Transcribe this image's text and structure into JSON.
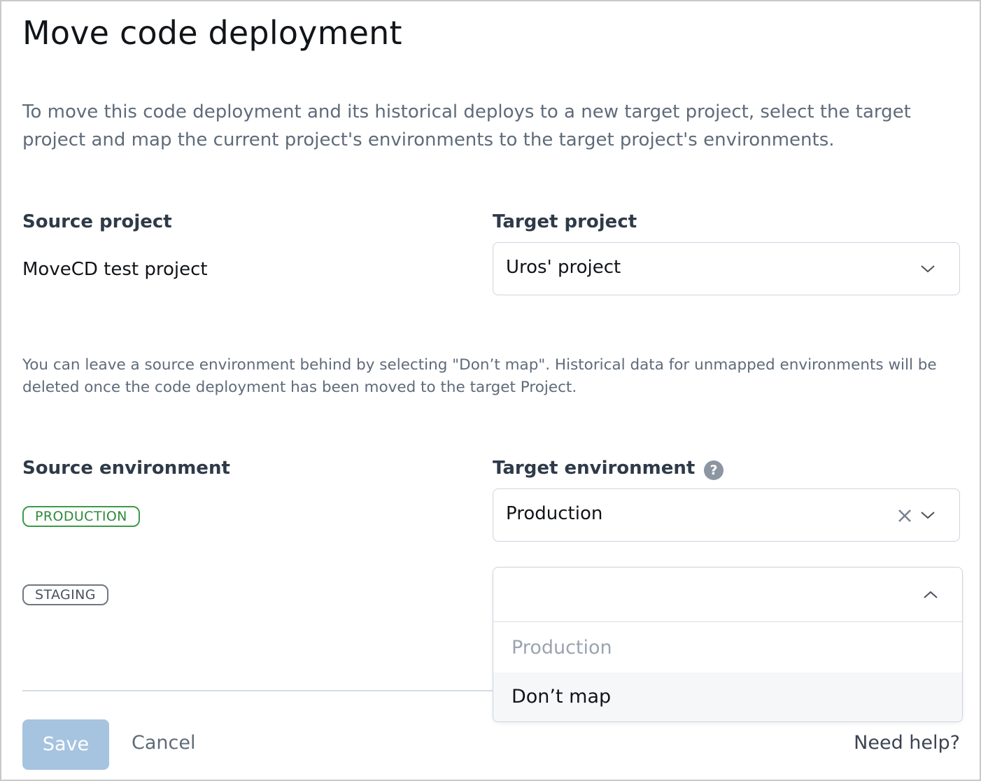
{
  "dialog": {
    "title": "Move code deployment",
    "intro": "To move this code deployment and its historical deploys to a new target project, select the target project and map the current project's environments to the target project's environments.",
    "source_project_label": "Source project",
    "source_project_value": "MoveCD test project",
    "target_project_label": "Target project",
    "target_project_value": "Uros' project",
    "note": "You can leave a source environment behind by selecting \"Don’t map\". Historical data for unmapped environments will be deleted once the code deployment has been moved to the target Project.",
    "source_env_label": "Source environment",
    "target_env_label": "Target environment",
    "help_icon_glyph": "?",
    "environments": [
      {
        "source": "PRODUCTION",
        "target": "Production"
      },
      {
        "source": "STAGING",
        "target": ""
      }
    ],
    "dropdown_options": [
      {
        "label": "Production",
        "disabled": true
      },
      {
        "label": "Don’t map",
        "disabled": false
      }
    ],
    "save_label": "Save",
    "cancel_label": "Cancel",
    "help_link": "Need help?"
  },
  "colors": {
    "production_badge": "#3d9a4a",
    "staging_badge": "#6f7782",
    "save_button": "#a6c4e0",
    "muted_text": "#5f6b7a"
  },
  "icons": {
    "chevron": "chevron-down-icon",
    "clear": "close-icon",
    "help": "question-circle-icon"
  }
}
